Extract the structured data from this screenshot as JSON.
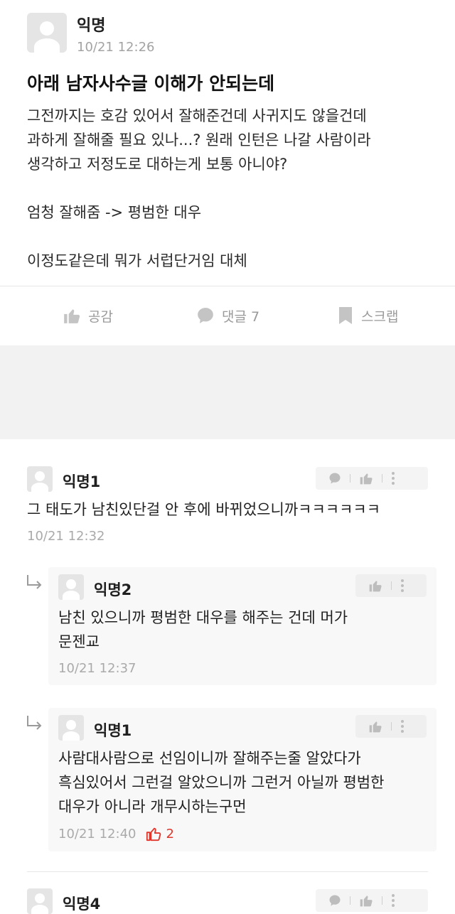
{
  "post": {
    "author": "익명",
    "time": "10/21 12:26",
    "title": "아래 남자사수글 이해가 안되는데",
    "body_lines": [
      "그전까지는 호감 있어서 잘해준건데 사귀지도 않을건데",
      "과하게 잘해줄 필요 있나...? 원래 인턴은 나갈 사람이라",
      "생각하고 저정도로 대하는게 보통 아니야?",
      "엄청 잘해줌  ->  평범한 대우",
      "이정도같은데 뭐가 서럽단거임 대체"
    ]
  },
  "actions": {
    "like_label": "공감",
    "comment_label": "댓글 7",
    "scrap_label": "스크랩"
  },
  "comments": [
    {
      "author": "익명1",
      "text_lines": [
        "그 태도가 남친있단걸 안 후에 바뀌었으니까ㅋㅋㅋㅋㅋㅋ"
      ],
      "time": "10/21 12:32"
    }
  ],
  "replies": [
    {
      "author": "익명2",
      "text_lines": [
        "남친 있으니까 평범한 대우를 해주는 건데 머가",
        "문젠교"
      ],
      "time": "10/21 12:37"
    },
    {
      "author": "익명1",
      "text_lines": [
        "사람대사람으로 선임이니까 잘해주는줄 알았다가",
        "흑심있어서 그런걸 알았으니까 그런거 아닐까 평범한",
        "대우가 아니라 개무시하는구먼"
      ],
      "time": "10/21 12:40",
      "likes": "2"
    }
  ],
  "next_comment": {
    "author": "익명4"
  },
  "colors": {
    "like_red": "#e0362c",
    "icon_gray": "#bdbdbd",
    "gray_band": "#f2f2f2"
  }
}
